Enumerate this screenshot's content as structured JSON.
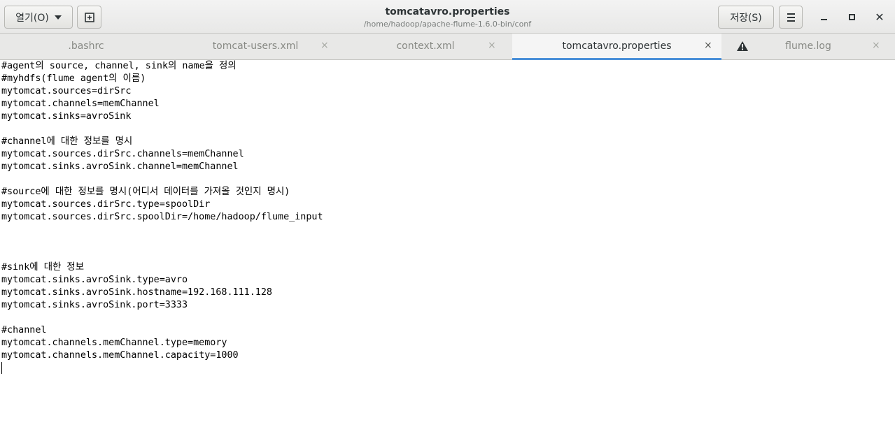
{
  "header": {
    "open_label": "열기(O)",
    "save_label": "저장(S)",
    "title": "tomcatavro.properties",
    "subtitle": "/home/hadoop/apache-flume-1.6.0-bin/conf",
    "icons": {
      "new_tab": "new-document-icon",
      "menu": "hamburger-menu-icon",
      "minimize": "minimize-icon",
      "maximize": "maximize-icon",
      "close": "close-icon"
    }
  },
  "tabs": [
    {
      "label": ".bashrc",
      "close": "×",
      "active": false
    },
    {
      "label": "tomcat-users.xml",
      "close": "×",
      "active": false
    },
    {
      "label": "context.xml",
      "close": "×",
      "active": false
    },
    {
      "label": "tomcatavro.properties",
      "close": "×",
      "active": true
    },
    {
      "label": "flume.log",
      "close": "×",
      "active": false,
      "icon": "warning-icon"
    }
  ],
  "accent_color": "#4a90d9",
  "editor": {
    "lines": [
      "#agent의 source, channel, sink의 name을 정의",
      "#myhdfs(flume agent의 이름)",
      "mytomcat.sources=dirSrc",
      "mytomcat.channels=memChannel",
      "mytomcat.sinks=avroSink",
      "",
      "#channel에 대한 정보를 명시",
      "mytomcat.sources.dirSrc.channels=memChannel",
      "mytomcat.sinks.avroSink.channel=memChannel",
      "",
      "#source에 대한 정보를 명시(어디서 데이터를 가져올 것인지 명시)",
      "mytomcat.sources.dirSrc.type=spoolDir",
      "mytomcat.sources.dirSrc.spoolDir=/home/hadoop/flume_input",
      "",
      "",
      "",
      "#sink에 대한 정보",
      "mytomcat.sinks.avroSink.type=avro",
      "mytomcat.sinks.avroSink.hostname=192.168.111.128",
      "mytomcat.sinks.avroSink.port=3333",
      "",
      "#channel",
      "mytomcat.channels.memChannel.type=memory",
      "mytomcat.channels.memChannel.capacity=1000",
      ""
    ]
  }
}
